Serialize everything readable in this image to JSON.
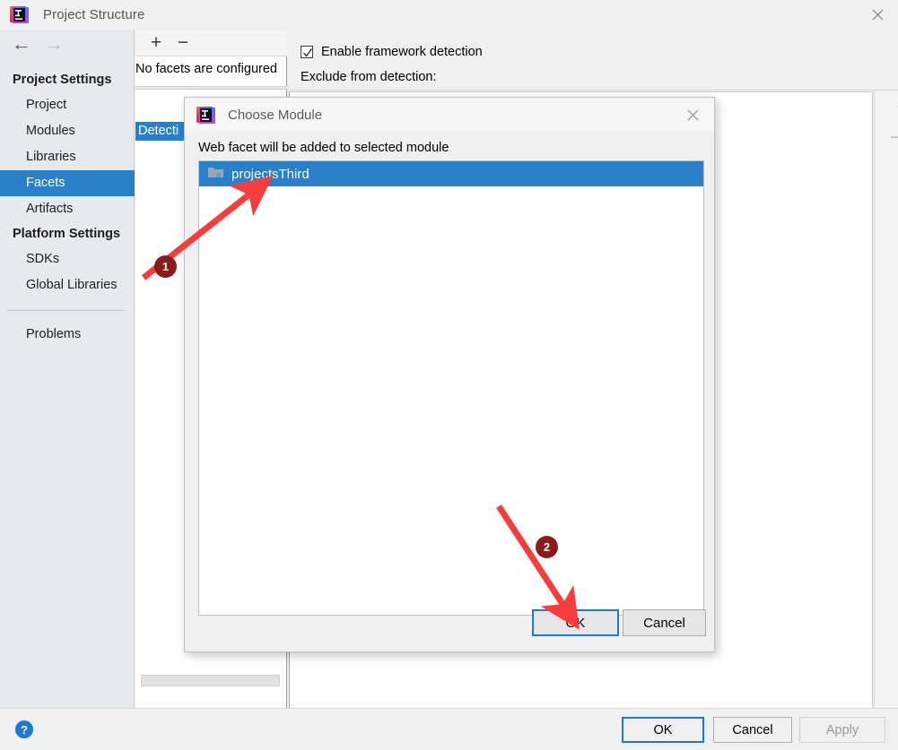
{
  "window": {
    "title": "Project Structure",
    "icon": "intellij-idea-logo",
    "close_label": "×"
  },
  "nav": {
    "back_icon": "←",
    "forward_icon": "→"
  },
  "sidebar": {
    "groups": [
      {
        "label": "Project Settings",
        "items": [
          {
            "label": "Project",
            "selected": false
          },
          {
            "label": "Modules",
            "selected": false
          },
          {
            "label": "Libraries",
            "selected": false
          },
          {
            "label": "Facets",
            "selected": true
          },
          {
            "label": "Artifacts",
            "selected": false
          }
        ]
      },
      {
        "label": "Platform Settings",
        "items": [
          {
            "label": "SDKs",
            "selected": false
          },
          {
            "label": "Global Libraries",
            "selected": false
          }
        ]
      }
    ],
    "problems_label": "Problems"
  },
  "facets": {
    "toolbar": {
      "add_label": "+",
      "remove_label": "−"
    },
    "empty_message": "No facets are configured",
    "selected_row": "Detecti",
    "selected_row_full": "Detection"
  },
  "detection": {
    "enable_checkbox_label": "Enable framework detection",
    "enable_checkbox_checked": true,
    "exclude_label": "Exclude from detection:",
    "add_label": "+",
    "remove_label": "−"
  },
  "footer": {
    "help_label": "?",
    "ok_label": "OK",
    "cancel_label": "Cancel",
    "apply_label": "Apply",
    "apply_disabled": true
  },
  "dialog": {
    "title": "Choose Module",
    "icon": "intellij-idea-logo",
    "close_label": "×",
    "prompt": "Web facet will be added to selected module",
    "modules": [
      {
        "label": "projectsThird",
        "icon": "module-folder-icon",
        "selected": true
      }
    ],
    "ok_label": "OK",
    "cancel_label": "Cancel"
  },
  "annotations": {
    "markers": [
      {
        "number": "1",
        "target": "projectsThird module row"
      },
      {
        "number": "2",
        "target": "dialog OK button"
      }
    ],
    "arrow_color": "#f53d3d",
    "badge_color": "#8b1a1a"
  },
  "colors": {
    "selection_blue": "#2a7fc9",
    "focus_blue": "#1a7ad4",
    "window_bg": "#f0f0f0",
    "sidebar_bg": "#e6eaed"
  }
}
